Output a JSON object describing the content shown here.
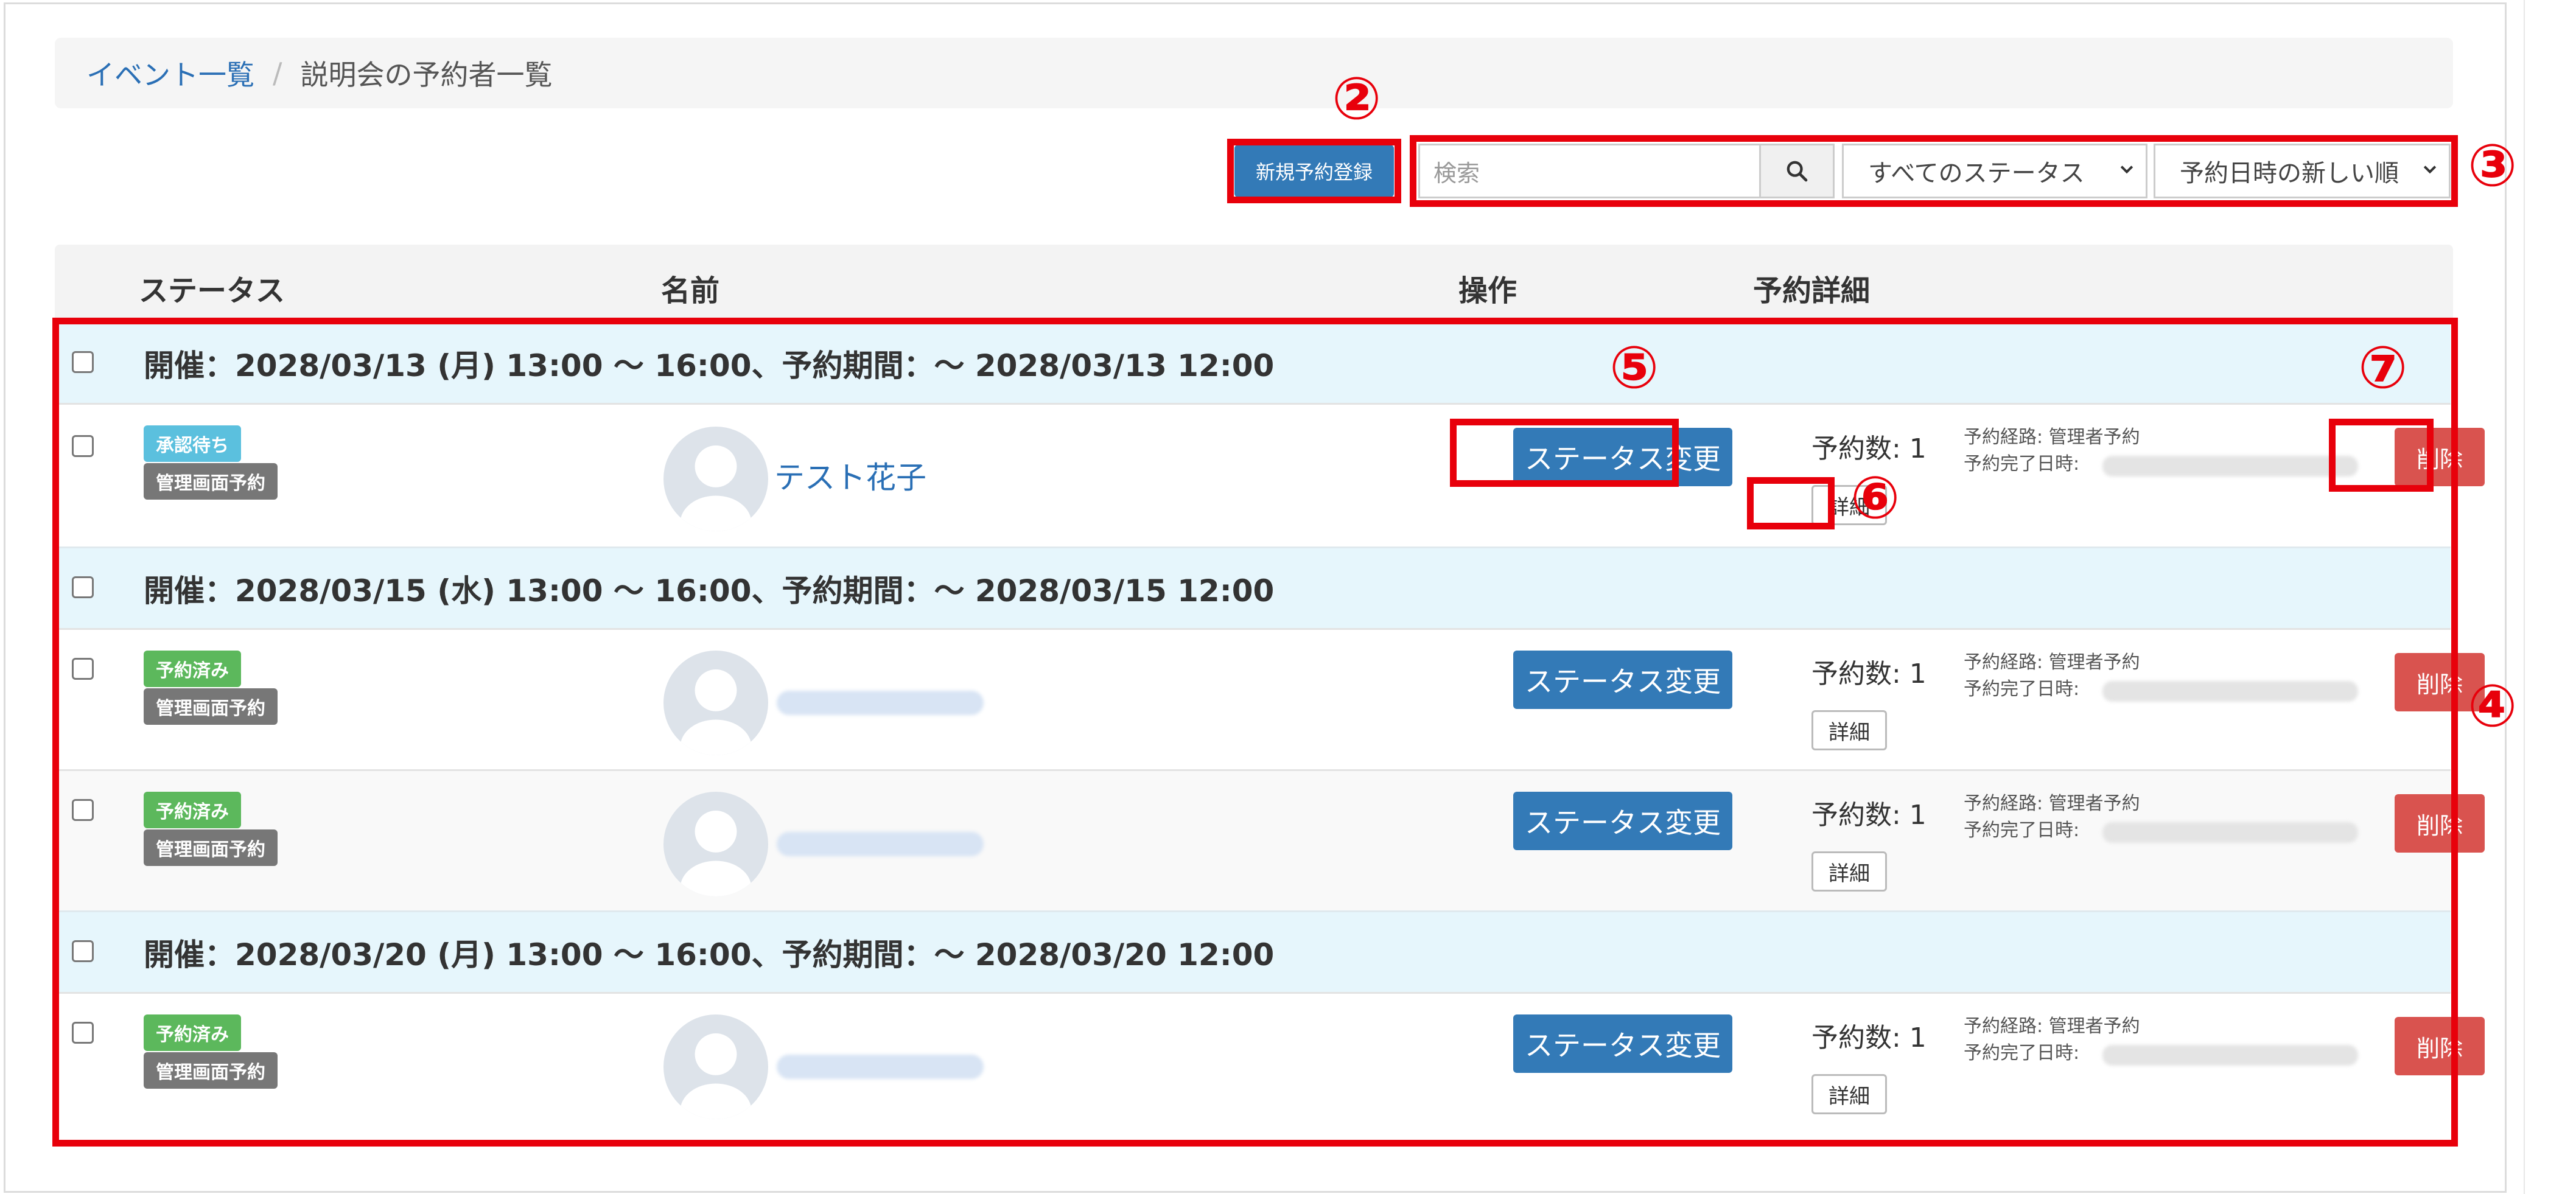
{
  "breadcrumb": {
    "parent": "イベント一覧",
    "separator": "/",
    "current": "説明会の予約者一覧"
  },
  "toolbar": {
    "new_button": "新規予約登録",
    "search_placeholder": "検索",
    "status_filter": "すべてのステータス",
    "sort_order": "予約日時の新しい順"
  },
  "table": {
    "headers": {
      "status": "ステータス",
      "name": "名前",
      "action": "操作",
      "detail": "予約詳細"
    }
  },
  "groups": [
    {
      "label": "開催：2028/03/13 (月) 13:00 ～ 16:00、予約期間：～ 2028/03/13 12:00"
    },
    {
      "label": "開催：2028/03/15 (水) 13:00 ～ 16:00、予約期間：～ 2028/03/15 12:00"
    },
    {
      "label": "開催：2028/03/20 (月) 13:00 ～ 16:00、予約期間：～ 2028/03/20 12:00"
    }
  ],
  "rows": [
    {
      "status": "承認待ち",
      "source": "管理画面予約",
      "name": "テスト花子",
      "action": "ステータス変更",
      "count": "予約数: 1",
      "route": "予約経路: 管理者予約",
      "completed": "予約完了日時:",
      "detail": "詳細",
      "delete": "削除"
    },
    {
      "status": "予約済み",
      "source": "管理画面予約",
      "name": "",
      "action": "ステータス変更",
      "count": "予約数: 1",
      "route": "予約経路: 管理者予約",
      "completed": "予約完了日時:",
      "detail": "詳細",
      "delete": "削除"
    },
    {
      "status": "予約済み",
      "source": "管理画面予約",
      "name": "",
      "action": "ステータス変更",
      "count": "予約数: 1",
      "route": "予約経路: 管理者予約",
      "completed": "予約完了日時:",
      "detail": "詳細",
      "delete": "削除"
    },
    {
      "status": "予約済み",
      "source": "管理画面予約",
      "name": "",
      "action": "ステータス変更",
      "count": "予約数: 1",
      "route": "予約経路: 管理者予約",
      "completed": "予約完了日時:",
      "detail": "詳細",
      "delete": "削除"
    }
  ],
  "markers": {
    "m2": "②",
    "m3": "③",
    "m4": "④",
    "m5": "⑤",
    "m6": "⑥",
    "m7": "⑦"
  },
  "colors": {
    "primary": "#337ab7",
    "danger": "#d9534f",
    "pending": "#5bc0de",
    "done": "#5cb85c",
    "annotation": "#e8000b"
  },
  "icons": {
    "search": "search-icon",
    "chevron": "chevron-down-icon",
    "avatar": "user-avatar-icon"
  }
}
